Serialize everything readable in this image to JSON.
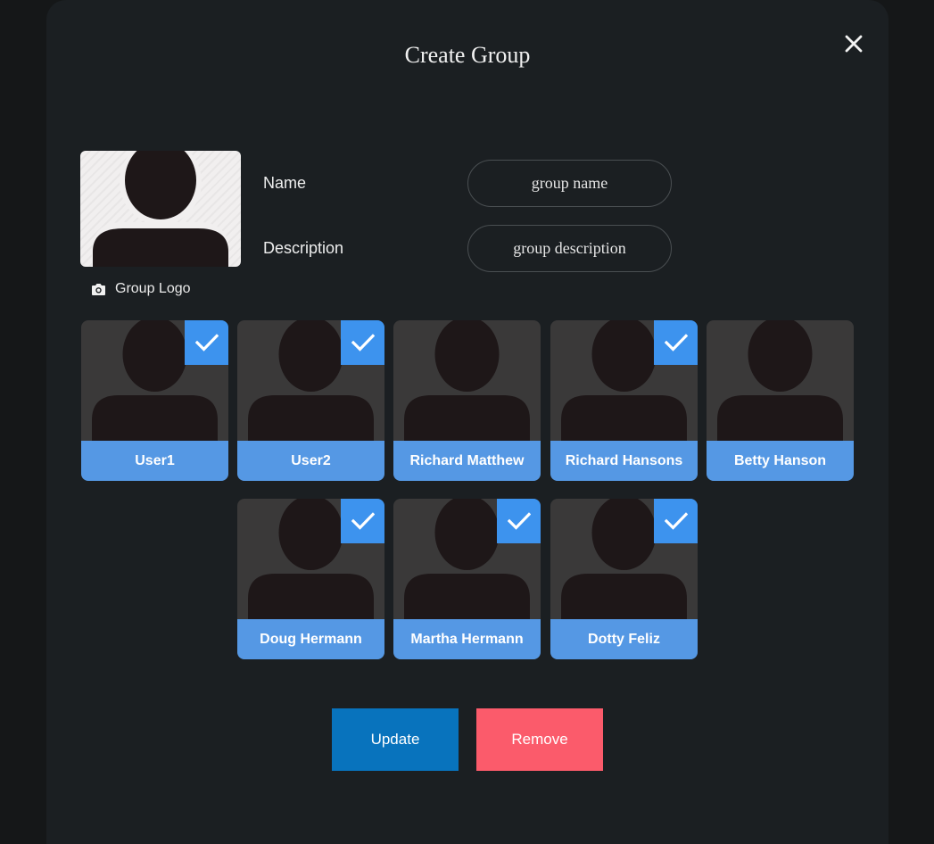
{
  "dialog": {
    "title": "Create Group"
  },
  "logo": {
    "caption": "Group Logo"
  },
  "form": {
    "name_label": "Name",
    "name_placeholder": "group name",
    "name_value": "",
    "description_label": "Description",
    "description_placeholder": "group description",
    "description_value": ""
  },
  "users": [
    {
      "name": "User1",
      "selected": true
    },
    {
      "name": "User2",
      "selected": true
    },
    {
      "name": "Richard Matthew",
      "selected": false
    },
    {
      "name": "Richard Hansons",
      "selected": true
    },
    {
      "name": "Betty Hanson",
      "selected": false
    },
    {
      "name": "Doug Hermann",
      "selected": true
    },
    {
      "name": "Martha Hermann",
      "selected": true
    },
    {
      "name": "Dotty Feliz",
      "selected": true
    }
  ],
  "actions": {
    "update_label": "Update",
    "remove_label": "Remove"
  },
  "colors": {
    "card_name_bg": "#5598e4",
    "check_bg": "#3d93ee",
    "update": "#0873bd",
    "remove": "#fb5b6b"
  }
}
